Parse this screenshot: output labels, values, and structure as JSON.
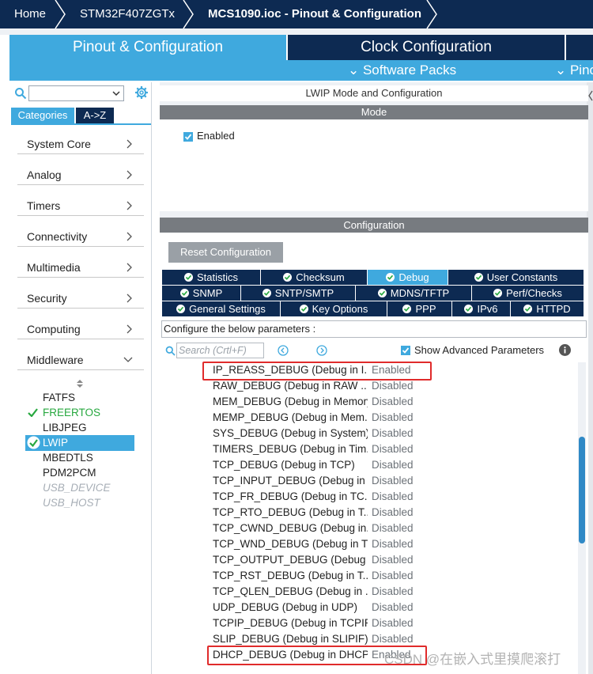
{
  "breadcrumb": [
    "Home",
    "STM32F407ZGTx",
    "MCS1090.ioc - Pinout & Configuration"
  ],
  "tabs": {
    "pinout": "Pinout & Configuration",
    "clock": "Clock Configuration",
    "software_packs": "⌄ Software Packs",
    "pinout_menu": "⌄ Pino"
  },
  "sidebar": {
    "tab_categories": "Categories",
    "tab_az": "A->Z",
    "categories": [
      "System Core",
      "Analog",
      "Timers",
      "Connectivity",
      "Multimedia",
      "Security",
      "Computing",
      "Middleware"
    ],
    "middleware_items": [
      {
        "label": "FATFS",
        "state": "normal"
      },
      {
        "label": "FREERTOS",
        "state": "enabled"
      },
      {
        "label": "LIBJPEG",
        "state": "normal"
      },
      {
        "label": "LWIP",
        "state": "selected"
      },
      {
        "label": "MBEDTLS",
        "state": "normal"
      },
      {
        "label": "PDM2PCM",
        "state": "normal"
      },
      {
        "label": "USB_DEVICE",
        "state": "disabled"
      },
      {
        "label": "USB_HOST",
        "state": "disabled"
      }
    ]
  },
  "mode_panel": {
    "title": "LWIP Mode and Configuration",
    "header": "Mode",
    "enabled_label": "Enabled",
    "enabled_checked": true
  },
  "config_panel": {
    "header": "Configuration",
    "reset_button": "Reset Configuration",
    "tabs_row1": [
      "Statistics",
      "Checksum",
      "Debug",
      "User Constants"
    ],
    "tabs_row2": [
      "SNMP",
      "SNTP/SMTP",
      "MDNS/TFTP",
      "Perf/Checks"
    ],
    "tabs_row3": [
      "General Settings",
      "Key Options",
      "PPP",
      "IPv6",
      "HTTPD"
    ],
    "selected_tab": "Debug",
    "hint": "Configure the below parameters :",
    "search_placeholder": "Search (Crtl+F)",
    "show_advanced_label": "Show Advanced Parameters",
    "show_advanced_checked": true
  },
  "params": [
    {
      "name": "IP_REASS_DEBUG (Debug in I...",
      "value": "Enabled",
      "highlighted": true
    },
    {
      "name": "RAW_DEBUG (Debug in RAW ...",
      "value": "Disabled"
    },
    {
      "name": "MEM_DEBUG (Debug in Memory)",
      "value": "Disabled"
    },
    {
      "name": "MEMP_DEBUG (Debug in Mem...",
      "value": "Disabled"
    },
    {
      "name": "SYS_DEBUG (Debug in System)",
      "value": "Disabled"
    },
    {
      "name": "TIMERS_DEBUG (Debug in Tim...",
      "value": "Disabled"
    },
    {
      "name": "TCP_DEBUG (Debug in TCP)",
      "value": "Disabled"
    },
    {
      "name": "TCP_INPUT_DEBUG (Debug in ...",
      "value": "Disabled"
    },
    {
      "name": "TCP_FR_DEBUG (Debug in TC...",
      "value": "Disabled"
    },
    {
      "name": "TCP_RTO_DEBUG (Debug in T...",
      "value": "Disabled"
    },
    {
      "name": "TCP_CWND_DEBUG (Debug in...",
      "value": "Disabled"
    },
    {
      "name": "TCP_WND_DEBUG (Debug in T...",
      "value": "Disabled"
    },
    {
      "name": "TCP_OUTPUT_DEBUG (Debug in",
      "value": "Disabled"
    },
    {
      "name": "TCP_RST_DEBUG (Debug in T...",
      "value": "Disabled"
    },
    {
      "name": "TCP_QLEN_DEBUG (Debug in ...",
      "value": "Disabled"
    },
    {
      "name": "UDP_DEBUG (Debug in UDP)",
      "value": "Disabled"
    },
    {
      "name": "TCPIP_DEBUG (Debug in TCPIP)",
      "value": "Disabled"
    },
    {
      "name": "SLIP_DEBUG (Debug in SLIPIF)",
      "value": "Disabled"
    },
    {
      "name": "DHCP_DEBUG (Debug in DHCP)",
      "value": "Enabled",
      "highlighted": true
    }
  ],
  "watermark": "CSDN @在嵌入式里摸爬滚打",
  "colors": {
    "navy": "#0d2a52",
    "accent": "#3fa9de",
    "highlight": "#e02b2b",
    "enabled_green": "#27a83f"
  }
}
